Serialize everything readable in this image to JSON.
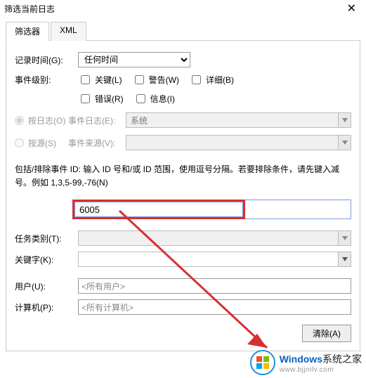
{
  "window": {
    "title": "筛选当前日志"
  },
  "tabs": {
    "filter": "筛选器",
    "xml": "XML"
  },
  "form": {
    "logged_label": "记录时间(G):",
    "logged_value": "任何时间",
    "level_label": "事件级别:",
    "level_critical": "关键(L)",
    "level_warning": "警告(W)",
    "level_verbose": "详细(B)",
    "level_error": "错误(R)",
    "level_info": "信息(I)",
    "by_log_label": "按日志(O)",
    "event_log_label": "事件日志(E):",
    "event_log_value": "系统",
    "by_source_label": "按源(S)",
    "event_source_label": "事件来源(V):",
    "help_text": "包括/排除事件 ID: 输入 ID 号和/或 ID 范围，使用逗号分隔。若要排除条件，请先键入减号。例如 1,3,5-99,-76(N)",
    "id_value": "6005",
    "task_label": "任务类别(T):",
    "keywords_label": "关键字(K):",
    "user_label": "用户(U):",
    "user_value": "<所有用户>",
    "computer_label": "计算机(P):",
    "computer_value": "<所有计算机>",
    "clear_btn": "清除(A)"
  },
  "watermark": {
    "brand_prefix": "Windows",
    "brand_suffix": "系统之家",
    "url": "www.bjjmlv.com"
  }
}
